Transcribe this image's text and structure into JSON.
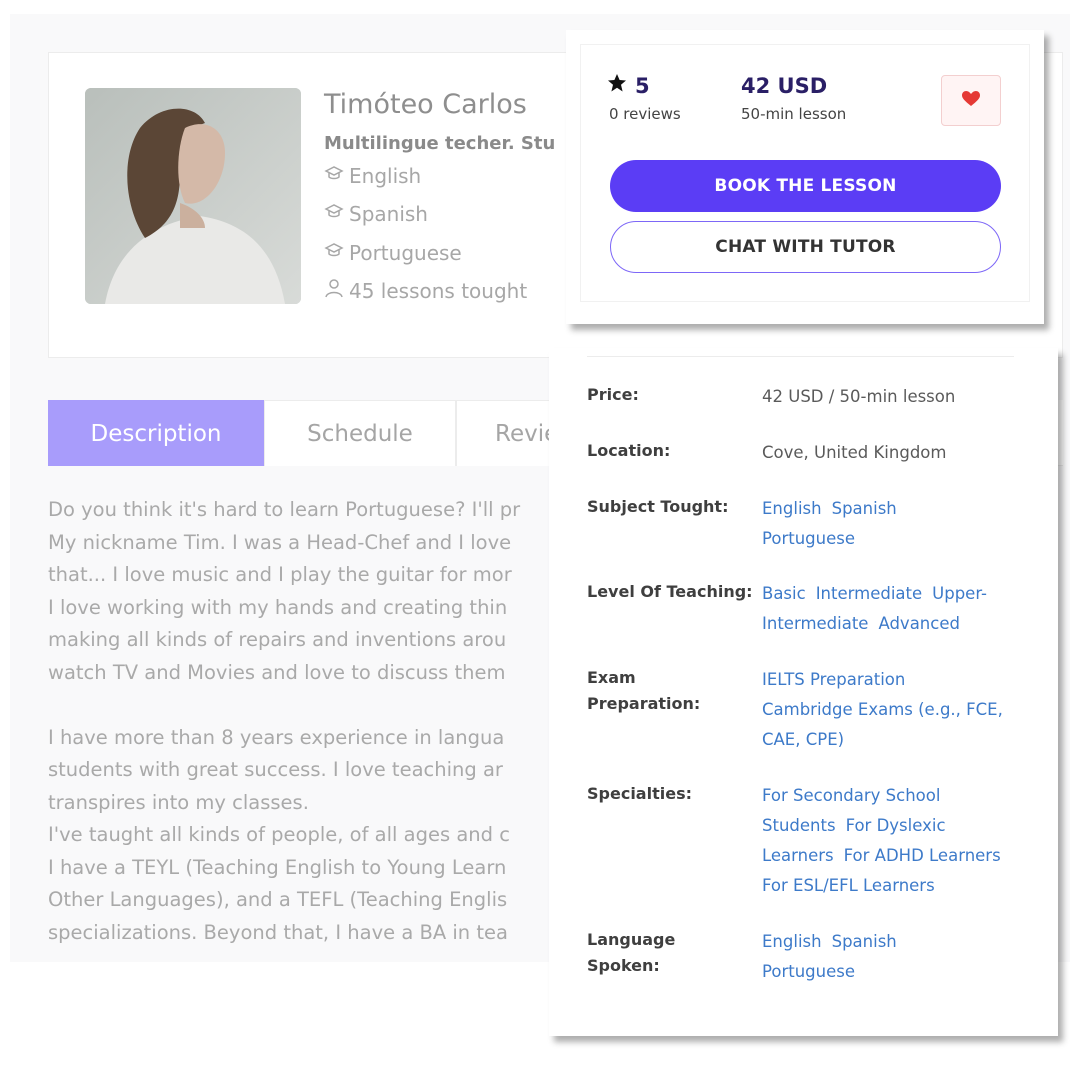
{
  "profile": {
    "name": "Timóteo Carlos",
    "headline": "Multilingue techer. Stu",
    "languages": [
      "English",
      "Spanish",
      "Portuguese"
    ],
    "lessons_taught": "45 lessons tought"
  },
  "tabs": [
    {
      "label": "Description",
      "active": true
    },
    {
      "label": "Schedule",
      "active": false
    },
    {
      "label": "Revie",
      "active": false
    }
  ],
  "description": {
    "paragraph1": [
      "Do you think it's hard to learn Portuguese? I'll pr",
      "My nickname Tim. I was a Head-Chef and I love",
      "that... I love music and I play the guitar for mor",
      "I love working with my hands and creating thin",
      "making all kinds of repairs and inventions arou",
      "watch TV and Movies and love to discuss them"
    ],
    "paragraph2": [
      "I have more than 8 years experience in langua",
      "students with great success. I love teaching ar",
      "transpires into my classes.",
      "I've taught all kinds of people, of all ages and c",
      "I have a TEYL (Teaching English to Young Learn",
      "Other Languages), and a TEFL (Teaching Englis",
      "specializations. Beyond that, I have a BA in tea"
    ]
  },
  "booking": {
    "rating": "5",
    "reviews": "0 reviews",
    "price": "42 USD",
    "price_unit": "50-min lesson",
    "book_label": "BOOK THE LESSON",
    "chat_label": "CHAT WITH TUTOR",
    "favorite_icon": "heart-icon"
  },
  "details": {
    "price": {
      "label": "Price:",
      "value": "42 USD / 50-min lesson"
    },
    "location": {
      "label": "Location:",
      "value": "Cove, United Kingdom"
    },
    "subjects": {
      "label": "Subject Tought:",
      "values": [
        "English",
        "Spanish",
        "Portuguese"
      ]
    },
    "levels": {
      "label": "Level Of Teaching:",
      "values": [
        "Basic",
        "Intermediate",
        "Upper-",
        "Intermediate",
        "Advanced"
      ]
    },
    "exams": {
      "label_line1": "Exam",
      "label_line2": "Preparation:",
      "values": [
        "IELTS Preparation",
        "Cambridge Exams (e.g., FCE,",
        "CAE, CPE)"
      ]
    },
    "specialties": {
      "label": "Specialties:",
      "values": [
        "For Secondary School",
        "Students",
        "For Dyslexic",
        "Learners",
        "For ADHD Learners",
        "For ESL/EFL Learners"
      ]
    },
    "spoken": {
      "label_line1": "Language",
      "label_line2": "Spoken:",
      "values": [
        "English",
        "Spanish",
        "Portuguese"
      ]
    }
  },
  "colors": {
    "accent": "#5b3df5",
    "tab_active": "#a89cfb",
    "link": "#3d7ac9",
    "heart": "#e53935"
  }
}
